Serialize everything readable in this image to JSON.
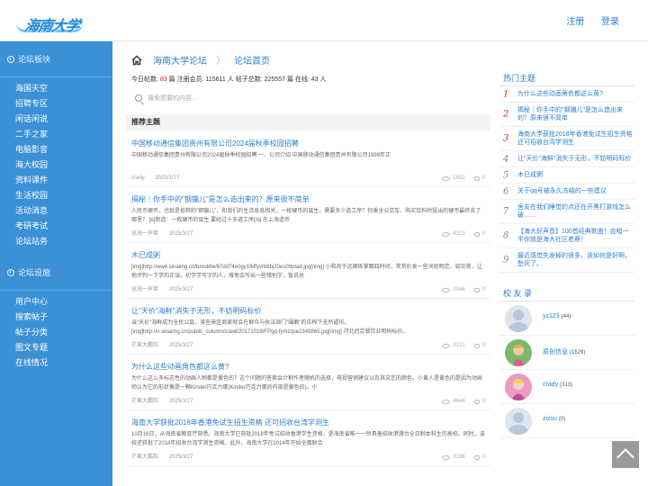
{
  "header": {
    "logo_text": "海南大学",
    "register": "注册",
    "login": "登录"
  },
  "sidebar": {
    "section1_title": "论坛板块",
    "section1_items": [
      "海国天空",
      "招聘专区",
      "闲话闲说",
      "二手之家",
      "电脑影音",
      "海大校园",
      "资料课件",
      "生活校园",
      "活动消息",
      "考研考试",
      "论坛站务"
    ],
    "section2_title": "论坛设施",
    "section2_items": [
      "用户中心",
      "搜索帖子",
      "帖子分类",
      "图文专题",
      "在线情况"
    ]
  },
  "breadcrumb": {
    "forum": "海南大学论坛",
    "page": "论坛首页"
  },
  "stats": {
    "today_label": "今日帖数:",
    "today_value": "83",
    "members_label": "篇 注册会员:",
    "members_value": "115611",
    "topics_label": "人 帖子总数:",
    "topics_value": "225557",
    "online_label": "篇 在线:",
    "online_value": "43",
    "online_unit": "人"
  },
  "search": {
    "placeholder": "搜索想要的内容..."
  },
  "recommend_title": "推荐主题",
  "posts": [
    {
      "title": "中国移动通信集团贵州有限公司2024届秋季校园招聘",
      "summary": "中国移动通信集团贵州有限公司2024届秋季校园招聘 一、公司介绍 中国移动通信集团贵州有限公司1999年正",
      "author": "crady",
      "date": "2025/3/27",
      "views": "1922",
      "replies": "0"
    },
    {
      "title": "揭秘｜你手中的\"钢镚儿\"是怎么造出来的？原来很不简单",
      "summary": "人民币硬币，也就是俗称的\"钢镚儿\"，和我们的生活息息相关。一枚硬币的诞生，需要多少道工序？你乘坐公交车、购买饮料时投出的硬币最终去了哪里？ [b]制造：一枚硬币的诞生 要经过十多道工序[/b] 在上海造币",
      "author": "沧海一声笑",
      "date": "2025/3/27",
      "views": "4323",
      "replies": "0"
    },
    {
      "title": "木已成粥",
      "summary": "[img]http://ww4.sinaimg.cn/bmiddle/67dd74e0gy1fkffyvrb6bj20es09ptad.jpg[/img] 小和尚于远卿练掌跟四时间，常常扒食一些词组明范，如见夜，让他评判一下学的正误。初学学写字的人，难免会写出一些错别字，暂说总",
      "author": "沧海一声笑",
      "date": "2025/3/27",
      "views": "3046",
      "replies": "0"
    },
    {
      "title": "让\"天价\"海鲜\"消失于无形，不妨明码标价",
      "summary": "当\"天价\"海鲜成为全民公敌，某些景区商家就会在群众与执法部门\"围剿\"的压榨下无所遁形。 [img]http://n.sinaimg.cn/public_column/crawl/20171019/FPgq-fymzqse2349865.jpg[/img] 河北冠芸餐饮业明码标价。",
      "author": "芒果大鹏粒",
      "date": "2025/3/27",
      "views": "3231",
      "replies": "0"
    },
    {
      "title": "为什么这些动画角色都这么黄?",
      "summary": "为什么这么多标志性的动画人物都是黄色的？这个问题的答案会计割作者随机的选择，电视营销建议以及其文艺的颜色。小黄人是黄色的是因为动画师认为它的形状像是一颗Kinder巧克力蛋(Kinder巧克力蛋的内部是黄色的)。小",
      "author": "芒果大鹏粒",
      "date": "2025/3/27",
      "views": "4644",
      "replies": "0"
    },
    {
      "title": "海南大学获批2018年香港免试生招生资格 还可招收台湾学测生",
      "summary": "10月16日，从海南省教育厅获悉。海南大学已获批2018年免试招收香港学生资格，是海南省唯一一所具备招收港澳台全日制本科生的高校。同时，该校还获批了2018年招收台湾学测生资格。此外，海南大学在2014年开始全面联合",
      "author": "芒果大鹏粒",
      "date": "2025/3/27",
      "views": "3336",
      "replies": "0"
    }
  ],
  "hot": {
    "title": "热门主题",
    "items": [
      "为什么这些动画角色都这么黄?",
      "揭秘｜你手中的\"钢镚儿\"是怎么造出来的？原来很不简单",
      "海南大学获批2018年香港免试生招生资格 还可招收台湾学测生",
      "让\"天价\"海鲜\"消失于无形，不妨明码标价",
      "木已成粥",
      "关于qq号被永久冻结的一些建议",
      "舍友在我们睡觉的点还在开黑打游戏怎么破……",
      "【海大好声音】100首经典歌曲！会唱一半你就是海大社区老蔡！",
      "最近感觉失发掉的很多，该如何是好啊，愁死了。"
    ],
    "numbers": [
      "1",
      "2",
      "3",
      "4",
      "5",
      "6",
      "7",
      "8",
      "9"
    ]
  },
  "friends": {
    "title": "校 友 录",
    "items": [
      {
        "name": "yz123",
        "count": "(44)"
      },
      {
        "name": "原创信息",
        "count": "(1529)"
      },
      {
        "name": "crady",
        "count": "(313)"
      },
      {
        "name": "zizsu",
        "count": "(0)"
      }
    ]
  },
  "colors": {
    "accent": "#3b91d6",
    "link": "#2a7fd0",
    "hot_rank": "#e02020"
  }
}
